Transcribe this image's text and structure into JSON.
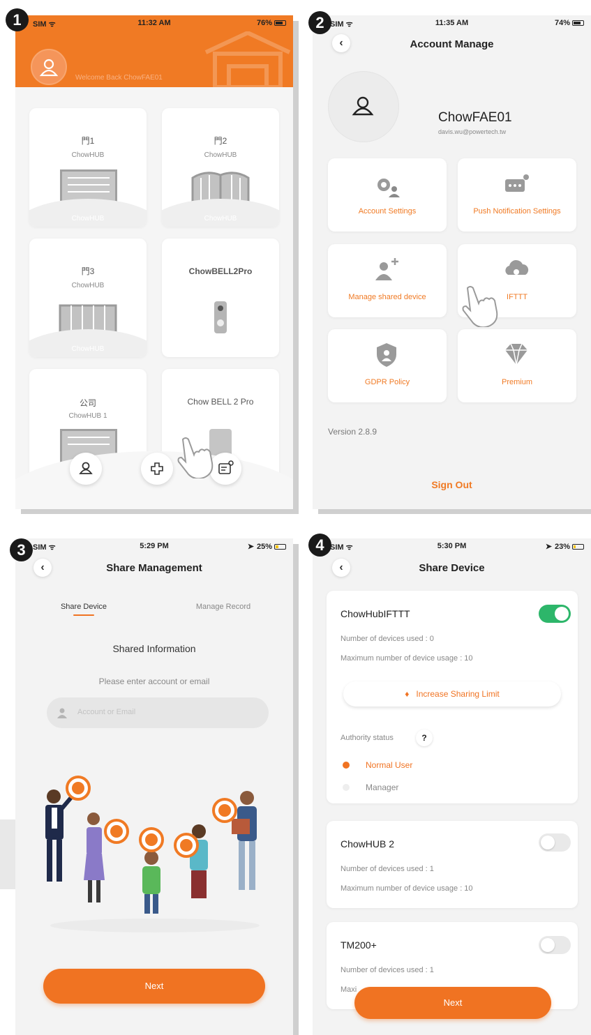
{
  "steps": [
    "1",
    "2",
    "3",
    "4"
  ],
  "screen1": {
    "status": {
      "carrier": "SIM ᯤ",
      "time": "11:32 AM",
      "battery": "76%"
    },
    "welcome": "Welcome Back ChowFAE01",
    "devices": [
      {
        "name": "門1",
        "sub": "ChowHUB",
        "footer": "ChowHUB"
      },
      {
        "name": "門2",
        "sub": "ChowHUB",
        "footer": "ChowHUB"
      },
      {
        "name": "門3",
        "sub": "ChowHUB",
        "footer": "ChowHUB"
      },
      {
        "name": "ChowBELL2Pro",
        "sub": "",
        "footer": ""
      },
      {
        "name": "公司",
        "sub": "ChowHUB 1",
        "footer": ""
      },
      {
        "name": "Chow BELL 2 Pro",
        "sub": "",
        "footer": ""
      }
    ]
  },
  "screen2": {
    "status": {
      "carrier": "SIM ᯤ",
      "time": "11:35 AM",
      "battery": "74%"
    },
    "title": "Account Manage",
    "username": "ChowFAE01",
    "email": "davis.wu@powertech.tw",
    "tiles": [
      "Account Settings",
      "Push Notification Settings",
      "Manage shared device",
      "IFTTT",
      "GDPR Policy",
      "Premium"
    ],
    "version": "Version 2.8.9",
    "signout": "Sign Out"
  },
  "screen3": {
    "status": {
      "carrier": "SIM ᯤ",
      "time": "5:29 PM",
      "battery": "25%",
      "loc": "➤"
    },
    "title": "Share Management",
    "tabs": [
      "Share Device",
      "Manage Record"
    ],
    "section": "Shared Information",
    "prompt": "Please enter account or email",
    "placeholder": "Account or Email",
    "next": "Next"
  },
  "screen4": {
    "status": {
      "carrier": "SIM ᯤ",
      "time": "5:30 PM",
      "battery": "23%",
      "loc": "➤"
    },
    "title": "Share Device",
    "devices": [
      {
        "name": "ChowHubIFTTT",
        "used": "Number of devices used :  0",
        "max": "Maximum number of device usage : 10",
        "on": true
      },
      {
        "name": "ChowHUB 2",
        "used": "Number of devices used :  1",
        "max": "Maximum number of device usage : 10",
        "on": false
      },
      {
        "name": "TM200+",
        "used": "Number of devices used :  1",
        "max": "Maxi",
        "on": false
      }
    ],
    "increase": "Increase Sharing Limit",
    "authority": "Authority status",
    "help": "?",
    "roles": [
      "Normal User",
      "Manager"
    ],
    "next": "Next"
  },
  "colors": {
    "accent": "#f07322",
    "toggle_on": "#2db66a"
  }
}
